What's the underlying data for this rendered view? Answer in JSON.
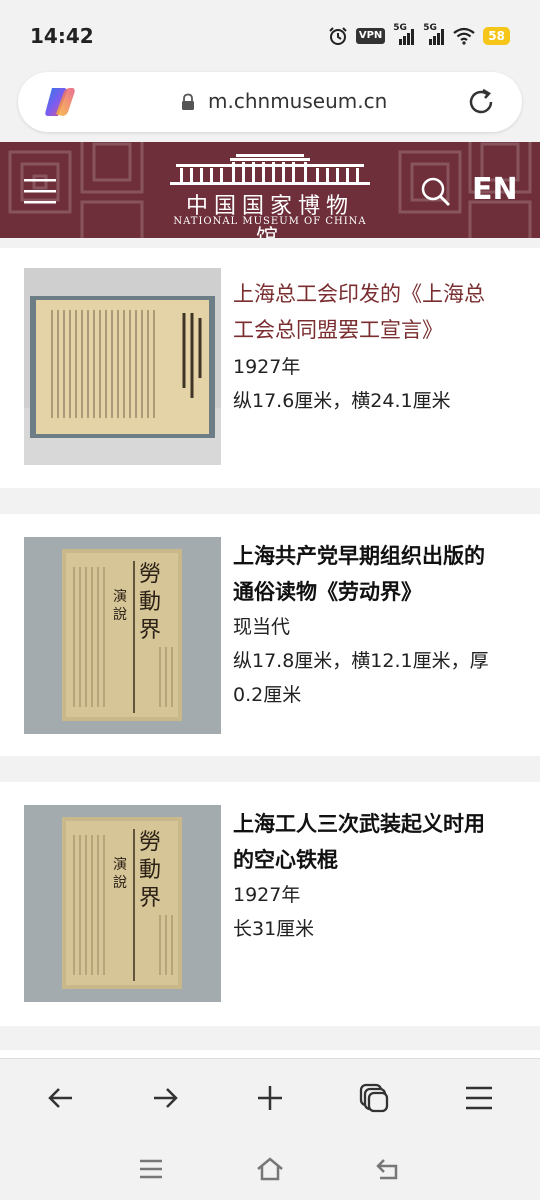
{
  "status_bar": {
    "time": "14:42",
    "vpn_label": "VPN",
    "sig1_label": "5G",
    "sig2_label": "5G",
    "battery": "58"
  },
  "browser": {
    "url": "m.chnmuseum.cn",
    "copilot_icon": "copilot-icon",
    "reload_icon": "reload-icon"
  },
  "site_header": {
    "logo_cn": "中国国家博物馆",
    "logo_en": "NATIONAL MUSEUM OF CHINA",
    "lang": "EN",
    "bg_color": "#6e2f3a"
  },
  "items": [
    {
      "title": "上海总工会印发的《上海总工会总同盟罢工宣言》",
      "title_lines": [
        "上海总工会印发的《上海总",
        "工会总同盟罢工宣言》"
      ],
      "meta": [
        "1927年",
        "纵17.6厘米，横24.1厘米"
      ],
      "highlight": true
    },
    {
      "title": "上海共产党早期组织出版的通俗读物《劳动界》",
      "title_lines": [
        "上海共产党早期组织出版的",
        "通俗读物《劳动界》"
      ],
      "meta": [
        "现当代",
        "纵17.8厘米，横12.1厘米，厚",
        "0.2厘米"
      ],
      "highlight": false
    },
    {
      "title": "上海工人三次武装起义时用的空心铁棍",
      "title_lines": [
        "上海工人三次武装起义时用",
        "的空心铁棍"
      ],
      "meta": [
        "1927年",
        "长31厘米"
      ],
      "highlight": false
    }
  ],
  "thumbnail_text": {
    "book_title": "勞動界",
    "book_section": "演說"
  },
  "colors": {
    "accent": "#7a2e30",
    "header": "#6e2f3a",
    "battery": "#f5c518"
  }
}
